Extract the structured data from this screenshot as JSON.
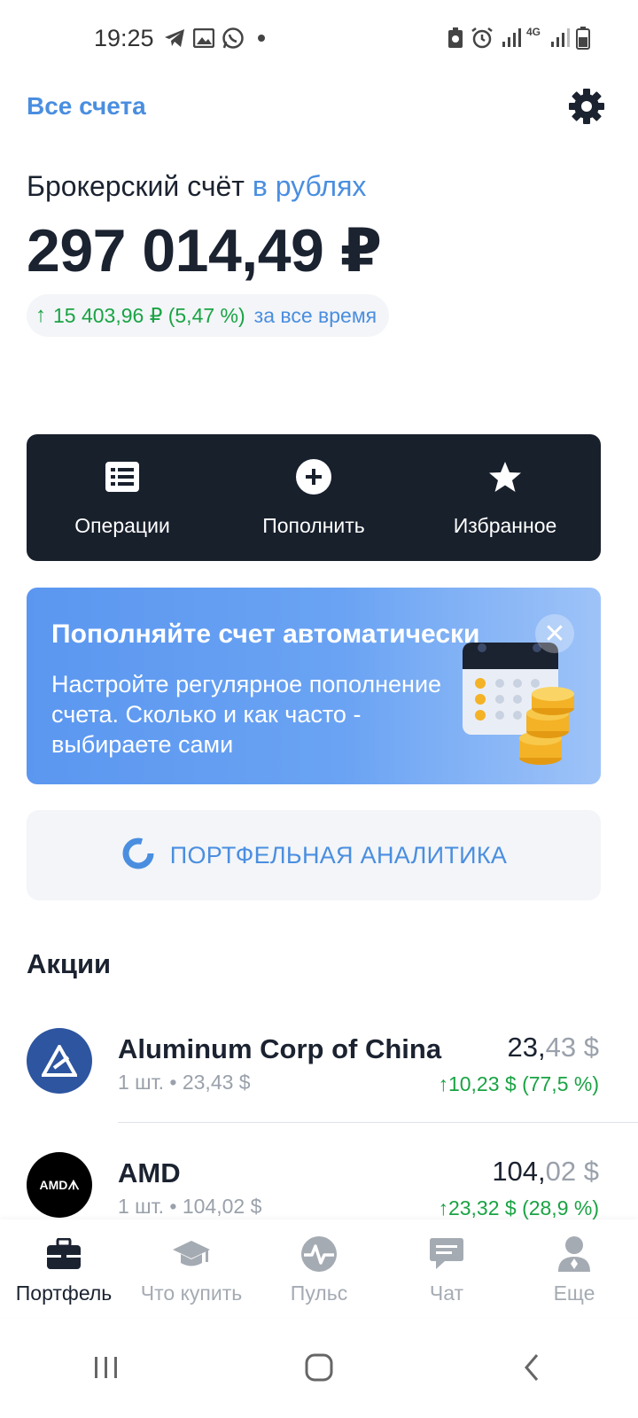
{
  "status_bar": {
    "time": "19:25",
    "network": "4G"
  },
  "header": {
    "all_accounts": "Все счета",
    "settings_icon": "gear-icon"
  },
  "account": {
    "title": "Брокерский счёт",
    "currency_label": "в рублях",
    "balance": "297 014,49 ₽",
    "gain_value": "15 403,96 ₽ (5,47 %)",
    "gain_period": "за все время"
  },
  "actions": [
    {
      "label": "Операции",
      "icon": "list-icon"
    },
    {
      "label": "Пополнить",
      "icon": "plus-circle-icon"
    },
    {
      "label": "Избранное",
      "icon": "star-icon"
    }
  ],
  "banner": {
    "title": "Пополняйте счет автоматически",
    "text": "Настройте регулярное пополнение счета. Сколько и как часто - выбираете сами",
    "close": "✕"
  },
  "analytics": {
    "label": "ПОРТФЕЛЬНАЯ АНАЛИТИКА"
  },
  "stocks": {
    "section_title": "Акции",
    "items": [
      {
        "name": "Aluminum Corp of China",
        "quantity": "1 шт. • 23,43 $",
        "price_int": "23,",
        "price_frac": "43 $",
        "change": "10,23 $ (77,5 %)",
        "logo_bg": "#2d55a0"
      },
      {
        "name": "AMD",
        "quantity": "1 шт. • 104,02 $",
        "price_int": "104,",
        "price_frac": "02 $",
        "change": "23,32 $ (28,9 %)",
        "logo_bg": "#000000",
        "logo_text": "AMDᗑ"
      }
    ]
  },
  "bottom_nav": [
    {
      "label": "Портфель",
      "icon": "briefcase-icon",
      "active": true
    },
    {
      "label": "Что купить",
      "icon": "graduation-cap-icon",
      "active": false
    },
    {
      "label": "Пульс",
      "icon": "pulse-icon",
      "active": false
    },
    {
      "label": "Чат",
      "icon": "chat-icon",
      "active": false
    },
    {
      "label": "Еще",
      "icon": "user-icon",
      "active": false
    }
  ],
  "colors": {
    "accent": "#4a8ee0",
    "positive": "#1aa344",
    "dark": "#18202c"
  }
}
